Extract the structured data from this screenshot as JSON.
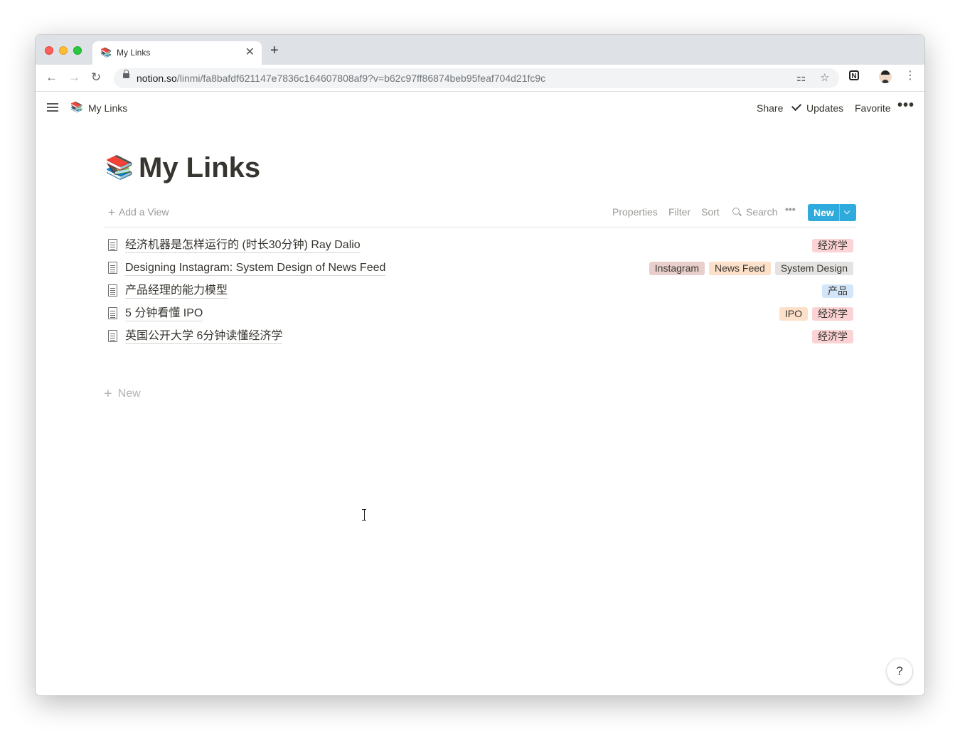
{
  "browser": {
    "tab": {
      "favicon": "📚",
      "title": "My Links",
      "close": "✕"
    },
    "new_tab": "+",
    "nav": {
      "back": "←",
      "forward": "→",
      "reload": "↻"
    },
    "url": {
      "host": "notion.so",
      "path": "/linmi/fa8bafdf621147e7836c164607808af9?v=b62c97ff86874beb95feaf704d21fc9c"
    },
    "translate_icon": "⚏",
    "star_icon": "☆",
    "ext_label": "N",
    "menu": "⋮"
  },
  "topbar": {
    "breadcrumb_icon": "📚",
    "breadcrumb_title": "My Links",
    "share": "Share",
    "updates": "Updates",
    "favorite": "Favorite",
    "more": "•••"
  },
  "page": {
    "icon": "📚",
    "title": "My Links"
  },
  "viewbar": {
    "add_view": "Add a View",
    "properties": "Properties",
    "filter": "Filter",
    "sort": "Sort",
    "search": "Search",
    "more": "•••",
    "new": "New"
  },
  "rows": [
    {
      "title": "经济机器是怎样运行的 (时长30分钟) Ray Dalio",
      "tags": [
        {
          "label": "经济学",
          "color": "#fbd3d4"
        }
      ]
    },
    {
      "title": "Designing Instagram: System Design of News Feed",
      "tags": [
        {
          "label": "Instagram",
          "color": "#e9cfcb"
        },
        {
          "label": "News Feed",
          "color": "#fde0c9"
        },
        {
          "label": "System Design",
          "color": "#e4e3e1"
        }
      ]
    },
    {
      "title": "产品经理的能力模型",
      "tags": [
        {
          "label": "产品",
          "color": "#d3e5f9"
        }
      ]
    },
    {
      "title": "5 分钟看懂 IPO",
      "tags": [
        {
          "label": "IPO",
          "color": "#fde0c9"
        },
        {
          "label": "经济学",
          "color": "#fbd3d4"
        }
      ]
    },
    {
      "title": "英国公开大学 6分钟读懂经济学",
      "tags": [
        {
          "label": "经济学",
          "color": "#fbd3d4"
        }
      ]
    }
  ],
  "new_row": "New",
  "help": "?"
}
